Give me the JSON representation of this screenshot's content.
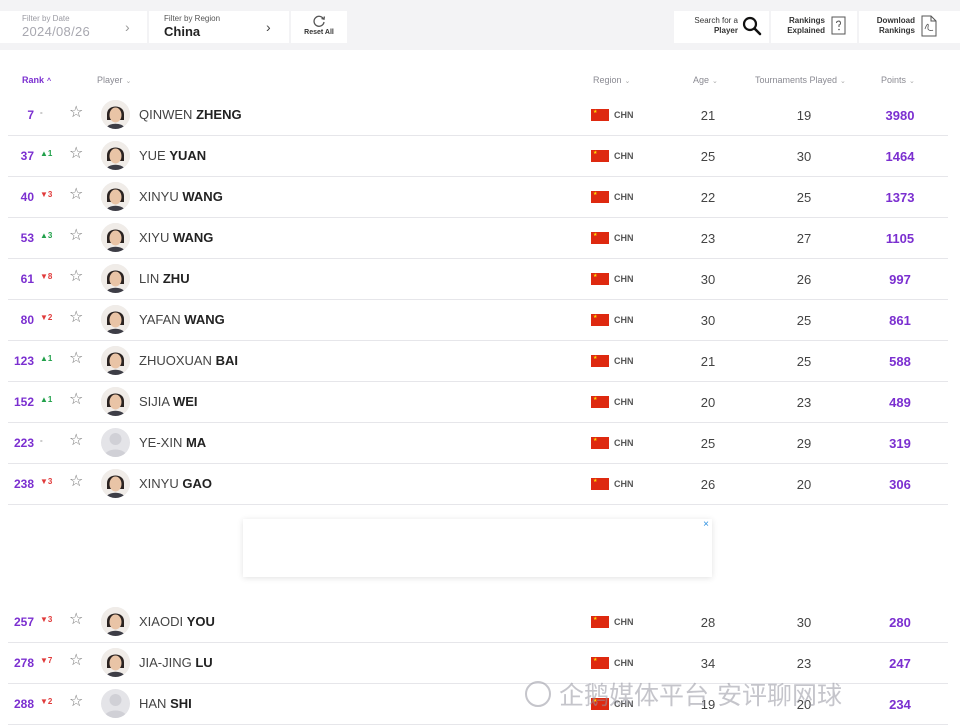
{
  "filters": {
    "date_label": "Filter by Date",
    "date_value": "2024/08/26",
    "region_label": "Filter by Region",
    "region_value": "China",
    "reset_label": "Reset All",
    "search_line1": "Search for a",
    "search_line2": "Player",
    "explained_line1": "Rankings",
    "explained_line2": "Explained",
    "download_line1": "Download",
    "download_line2": "Rankings",
    "chevron": "›"
  },
  "columns": {
    "rank": "Rank",
    "player": "Player",
    "region": "Region",
    "age": "Age",
    "tournaments": "Tournaments Played",
    "points": "Points",
    "sort_up": "^",
    "sort_caret": "⌄"
  },
  "star_glyph": "☆",
  "rows": [
    {
      "rank": "7",
      "movement": "-",
      "first": "QINWEN",
      "last": "ZHENG",
      "region": "CHN",
      "age": "21",
      "tournaments": "19",
      "points": "3980"
    },
    {
      "rank": "37",
      "movement": "▲1",
      "first": "YUE",
      "last": "YUAN",
      "region": "CHN",
      "age": "25",
      "tournaments": "30",
      "points": "1464"
    },
    {
      "rank": "40",
      "movement": "▼3",
      "first": "XINYU",
      "last": "WANG",
      "region": "CHN",
      "age": "22",
      "tournaments": "25",
      "points": "1373"
    },
    {
      "rank": "53",
      "movement": "▲3",
      "first": "XIYU",
      "last": "WANG",
      "region": "CHN",
      "age": "23",
      "tournaments": "27",
      "points": "1105"
    },
    {
      "rank": "61",
      "movement": "▼8",
      "first": "LIN",
      "last": "ZHU",
      "region": "CHN",
      "age": "30",
      "tournaments": "26",
      "points": "997"
    },
    {
      "rank": "80",
      "movement": "▼2",
      "first": "YAFAN",
      "last": "WANG",
      "region": "CHN",
      "age": "30",
      "tournaments": "25",
      "points": "861"
    },
    {
      "rank": "123",
      "movement": "▲1",
      "first": "ZHUOXUAN",
      "last": "BAI",
      "region": "CHN",
      "age": "21",
      "tournaments": "25",
      "points": "588"
    },
    {
      "rank": "152",
      "movement": "▲1",
      "first": "SIJIA",
      "last": "WEI",
      "region": "CHN",
      "age": "20",
      "tournaments": "23",
      "points": "489"
    },
    {
      "rank": "223",
      "movement": "-",
      "first": "YE-XIN",
      "last": "MA",
      "region": "CHN",
      "age": "25",
      "tournaments": "29",
      "points": "319"
    },
    {
      "rank": "238",
      "movement": "▼3",
      "first": "XINYU",
      "last": "GAO",
      "region": "CHN",
      "age": "26",
      "tournaments": "20",
      "points": "306"
    },
    {
      "rank": "257",
      "movement": "▼3",
      "first": "XIAODI",
      "last": "YOU",
      "region": "CHN",
      "age": "28",
      "tournaments": "30",
      "points": "280"
    },
    {
      "rank": "278",
      "movement": "▼7",
      "first": "JIA-JING",
      "last": "LU",
      "region": "CHN",
      "age": "34",
      "tournaments": "23",
      "points": "247"
    },
    {
      "rank": "288",
      "movement": "▼2",
      "first": "HAN",
      "last": "SHI",
      "region": "CHN",
      "age": "19",
      "tournaments": "20",
      "points": "234"
    }
  ],
  "ad": {
    "close": "×"
  },
  "watermark": "企鹅媒体平台 安评聊网球",
  "colors": {
    "accent": "#7b2fd0",
    "up": "#21a04a",
    "down": "#e03a3a",
    "flag": "#de2910"
  }
}
